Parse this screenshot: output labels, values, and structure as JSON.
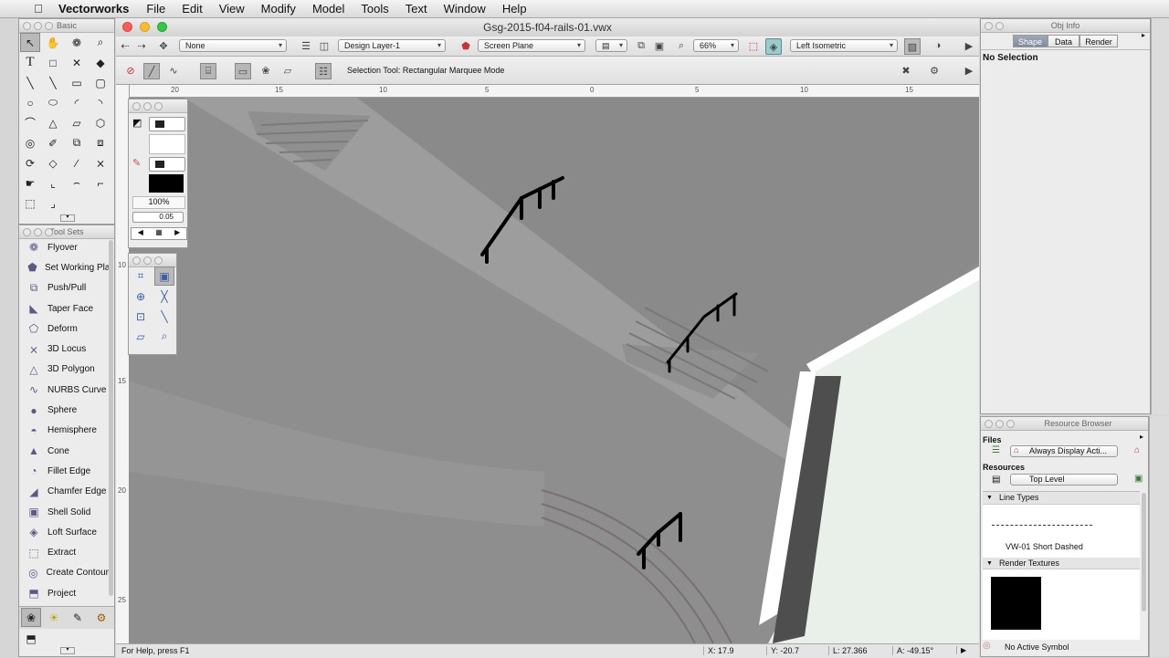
{
  "menubar": {
    "app_name": "Vectorworks",
    "items": [
      "File",
      "Edit",
      "View",
      "Modify",
      "Model",
      "Tools",
      "Text",
      "Window",
      "Help"
    ]
  },
  "basic_palette": {
    "title": "Basic"
  },
  "toolsets_palette": {
    "title": "Tool Sets",
    "items": [
      {
        "label": "Flyover",
        "icon": "flyover-icon"
      },
      {
        "label": "Set Working Plane",
        "icon": "working-plane-icon"
      },
      {
        "label": "Push/Pull",
        "icon": "push-pull-icon"
      },
      {
        "label": "Taper Face",
        "icon": "taper-face-icon"
      },
      {
        "label": "Deform",
        "icon": "deform-icon"
      },
      {
        "label": "3D Locus",
        "icon": "locus-icon"
      },
      {
        "label": "3D Polygon",
        "icon": "polygon-3d-icon"
      },
      {
        "label": "NURBS Curve",
        "icon": "nurbs-curve-icon"
      },
      {
        "label": "Sphere",
        "icon": "sphere-icon"
      },
      {
        "label": "Hemisphere",
        "icon": "hemisphere-icon"
      },
      {
        "label": "Cone",
        "icon": "cone-icon"
      },
      {
        "label": "Fillet Edge",
        "icon": "fillet-edge-icon"
      },
      {
        "label": "Chamfer Edge",
        "icon": "chamfer-edge-icon"
      },
      {
        "label": "Shell Solid",
        "icon": "shell-solid-icon"
      },
      {
        "label": "Loft Surface",
        "icon": "loft-surface-icon"
      },
      {
        "label": "Extract",
        "icon": "extract-icon"
      },
      {
        "label": "Create Contours",
        "icon": "contours-icon"
      },
      {
        "label": "Project",
        "icon": "project-icon"
      }
    ]
  },
  "attributes_palette": {
    "opacity": "100%",
    "line_weight": "0.05"
  },
  "document": {
    "title": "Gsg-2015-f04-rails-01.vwx",
    "class_select": "None",
    "layer_select": "Design Layer-1",
    "plane_select": "Screen Plane",
    "zoom": "66%",
    "view_select": "Left Isometric",
    "mode_text": "Selection Tool: Rectangular Marquee Mode"
  },
  "ruler_top": [
    "20",
    "15",
    "10",
    "5",
    "0",
    "5",
    "10",
    "15"
  ],
  "ruler_left": [
    "10",
    "15",
    "20",
    "25"
  ],
  "status": {
    "help": "For Help, press F1",
    "x": "X: 17.9",
    "y": "Y: -20.7",
    "l": "L: 27.366",
    "a": "A: -49.15°"
  },
  "obj_info": {
    "title": "Obj Info",
    "tabs": [
      "Shape",
      "Data",
      "Render"
    ],
    "active_tab": "Shape",
    "selection": "No Selection"
  },
  "resource_browser": {
    "title": "Resource Browser",
    "files_label": "Files",
    "files_value": "Always Display Acti...",
    "resources_label": "Resources",
    "resources_value": "Top Level",
    "section_line_types": "Line Types",
    "line_type_name": "VW-01 Short Dashed",
    "section_render_textures": "Render Textures",
    "active_symbol": "No Active Symbol"
  }
}
